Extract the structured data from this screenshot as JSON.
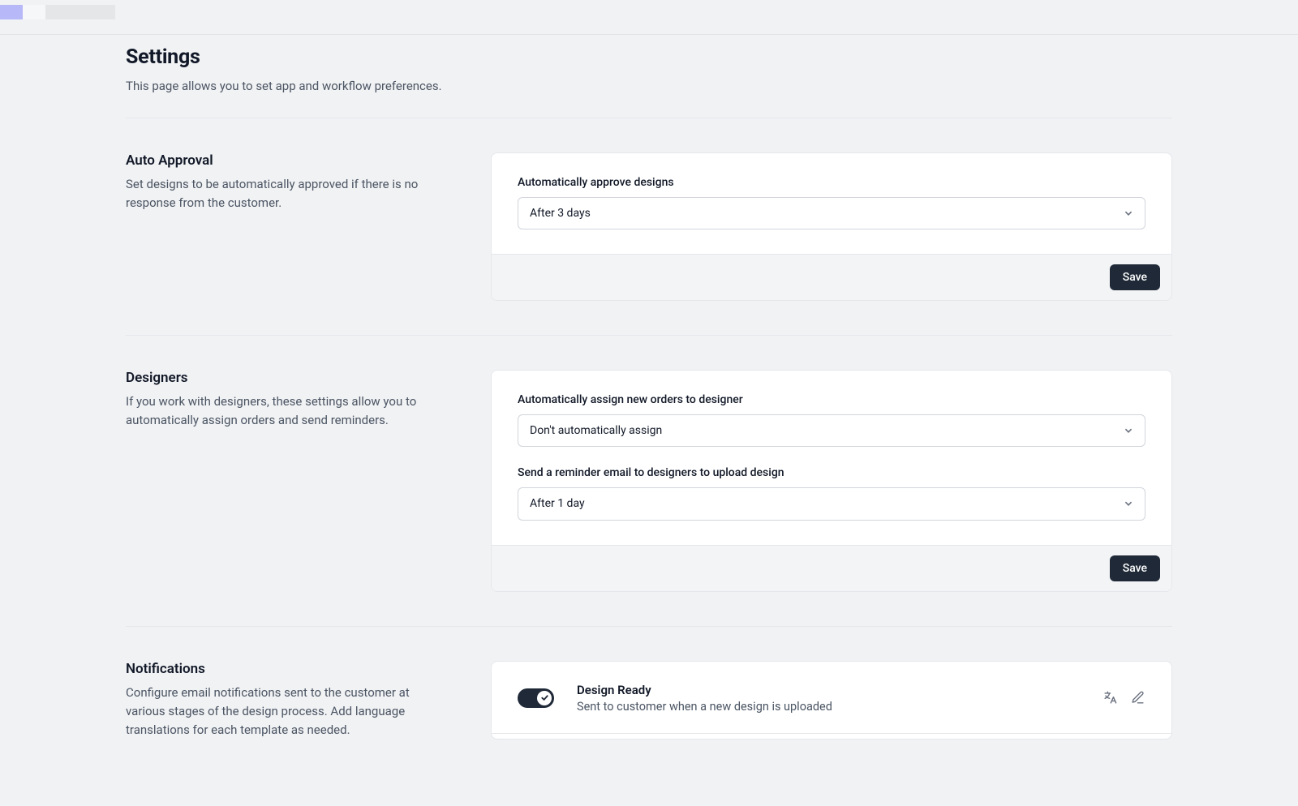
{
  "header": {
    "title": "Settings",
    "subtitle": "This page allows you to set app and workflow preferences."
  },
  "autoApproval": {
    "title": "Auto Approval",
    "desc": "Set designs to be automatically approved if there is no response from the customer.",
    "fieldLabel": "Automatically approve designs",
    "selected": "After 3 days",
    "saveLabel": "Save"
  },
  "designers": {
    "title": "Designers",
    "desc": "If you work with designers, these settings allow you to automatically assign orders and send reminders.",
    "assignLabel": "Automatically assign new orders to designer",
    "assignSelected": "Don't automatically assign",
    "reminderLabel": "Send a reminder email to designers to upload design",
    "reminderSelected": "After 1 day",
    "saveLabel": "Save"
  },
  "notifications": {
    "title": "Notifications",
    "desc": "Configure email notifications sent to the customer at various stages of the design process. Add language translations for each template as needed.",
    "items": [
      {
        "title": "Design Ready",
        "desc": "Sent to customer when a new design is uploaded",
        "enabled": true
      }
    ]
  }
}
